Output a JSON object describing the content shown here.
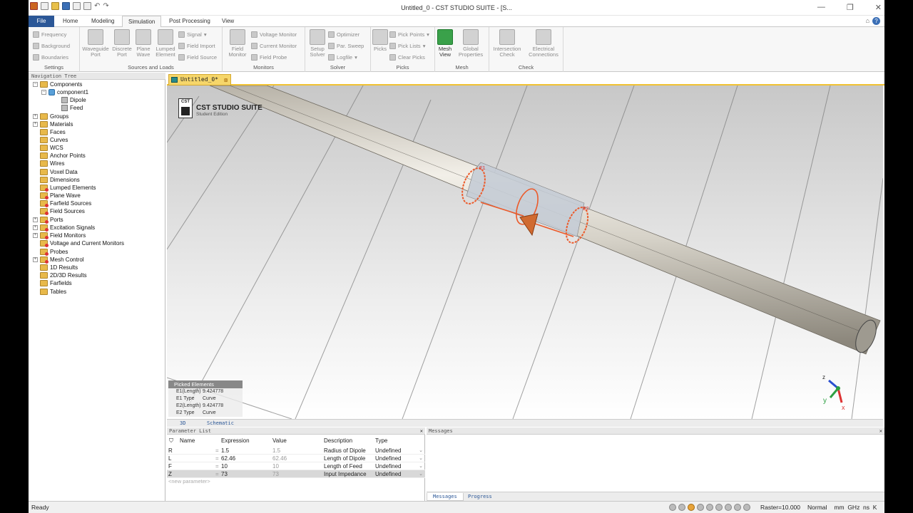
{
  "window": {
    "title": "Untitled_0 - CST STUDIO SUITE - [S...",
    "controls": [
      "—",
      "❐",
      "✕"
    ]
  },
  "tabs": [
    "File",
    "Home",
    "Modeling",
    "Simulation",
    "Post Processing",
    "View"
  ],
  "ribbon": {
    "settings": {
      "items": [
        "Frequency",
        "Background",
        "Boundaries"
      ],
      "label": "Settings"
    },
    "sources": {
      "waveguide": "Waveguide Port",
      "discrete": "Discrete Port",
      "plane": "Plane Wave",
      "lumped": "Lumped Element",
      "signal": "Signal",
      "field_import": "Field Import",
      "field_source": "Field Source",
      "label": "Sources and Loads"
    },
    "monitors": {
      "field": "Field Monitor",
      "voltage": "Voltage Monitor",
      "current": "Current Monitor",
      "probe": "Field Probe",
      "label": "Monitors"
    },
    "solver": {
      "setup": "Setup Solver",
      "optimizer": "Optimizer",
      "par_sweep": "Par. Sweep",
      "logfile": "Logfile",
      "label": "Solver"
    },
    "picks": {
      "picks": "Picks",
      "pick_points": "Pick Points",
      "pick_lists": "Pick Lists",
      "clear": "Clear Picks",
      "label": "Picks"
    },
    "mesh": {
      "mesh_view": "Mesh View",
      "global": "Global Properties",
      "label": "Mesh"
    },
    "check": {
      "intersection": "Intersection Check",
      "electrical": "Electrical Connections",
      "label": "Check"
    }
  },
  "nav": {
    "header": "Navigation Tree",
    "items": [
      "Components",
      "component1",
      "Dipole",
      "Feed",
      "Groups",
      "Materials",
      "Faces",
      "Curves",
      "WCS",
      "Anchor Points",
      "Wires",
      "Voxel Data",
      "Dimensions",
      "Lumped Elements",
      "Plane Wave",
      "Farfield Sources",
      "Field Sources",
      "Ports",
      "Excitation Signals",
      "Field Monitors",
      "Voltage and Current Monitors",
      "Probes",
      "Mesh Control",
      "1D Results",
      "2D/3D Results",
      "Farfields",
      "Tables"
    ]
  },
  "doc_tab": "Untitled_0*",
  "viewport": {
    "logo_title": "CST STUDIO SUITE",
    "logo_sub": "Student Edition",
    "logo_mark": "CST",
    "labels": {
      "e1": "E1",
      "e2": "E2"
    },
    "axes": {
      "z": "z",
      "y": "y",
      "x": "x"
    },
    "picked": {
      "title": "Picked Elements",
      "rows": [
        {
          "k": "E1(Length)",
          "v": "9.424778"
        },
        {
          "k": "E1 Type",
          "v": "Curve"
        },
        {
          "k": "E2(Length)",
          "v": "9.424778"
        },
        {
          "k": "E2 Type",
          "v": "Curve"
        }
      ]
    }
  },
  "view_tabs": [
    "3D",
    "Schematic"
  ],
  "params": {
    "header": "Parameter List",
    "columns": [
      "Name",
      "Expression",
      "Value",
      "Description",
      "Type"
    ],
    "rows": [
      {
        "name": "R",
        "expr": "1.5",
        "val": "1.5",
        "desc": "Radius of Dipole",
        "type": "Undefined"
      },
      {
        "name": "L",
        "expr": "62.46",
        "val": "62.46",
        "desc": "Length of Dipole",
        "type": "Undefined"
      },
      {
        "name": "F",
        "expr": "10",
        "val": "10",
        "desc": "Length of Feed",
        "type": "Undefined"
      },
      {
        "name": "Z",
        "expr": "73",
        "val": "73",
        "desc": "Input Impedance",
        "type": "Undefined"
      }
    ],
    "new_placeholder": "<new parameter>"
  },
  "messages": {
    "header": "Messages",
    "tabs": [
      "Messages",
      "Progress"
    ]
  },
  "status": {
    "left": "Ready",
    "raster": "Raster=10.000",
    "mode": "Normal",
    "units": [
      "mm",
      "GHz",
      "ns",
      "K"
    ]
  }
}
